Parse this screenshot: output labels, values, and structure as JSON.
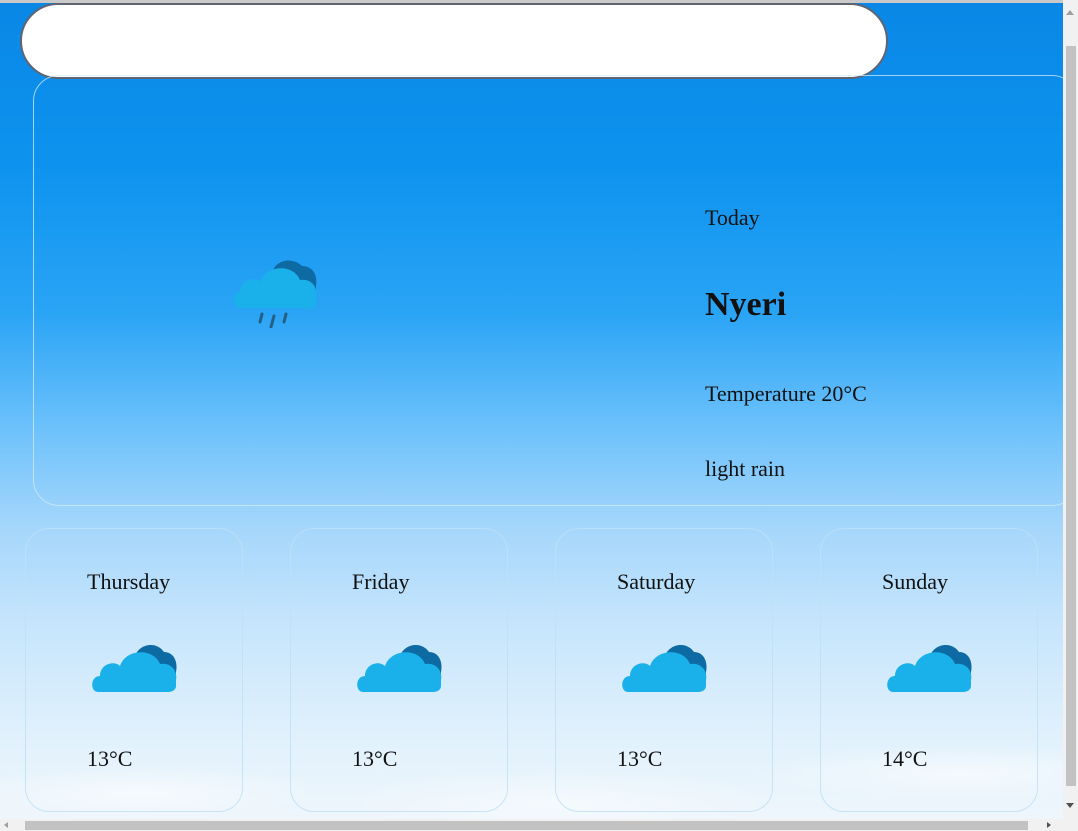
{
  "search": {
    "value": "",
    "placeholder": ""
  },
  "current": {
    "day_label": "Today",
    "city": "Nyeri",
    "temperature_text": "Temperature 20°C",
    "description": "light rain",
    "icon": "cloud-rain-icon"
  },
  "forecast": [
    {
      "day": "Thursday",
      "temp": "13°C",
      "icon": "cloud-icon"
    },
    {
      "day": "Friday",
      "temp": "13°C",
      "icon": "cloud-icon"
    },
    {
      "day": "Saturday",
      "temp": "13°C",
      "icon": "cloud-icon"
    },
    {
      "day": "Sunday",
      "temp": "14°C",
      "icon": "cloud-icon"
    }
  ],
  "colors": {
    "cloud_front": "#1ab0ea",
    "cloud_back": "#0d6aa3",
    "rain_drops": "#245f88",
    "sky_top": "#0a87e6",
    "sky_bottom": "#eef6fc"
  }
}
